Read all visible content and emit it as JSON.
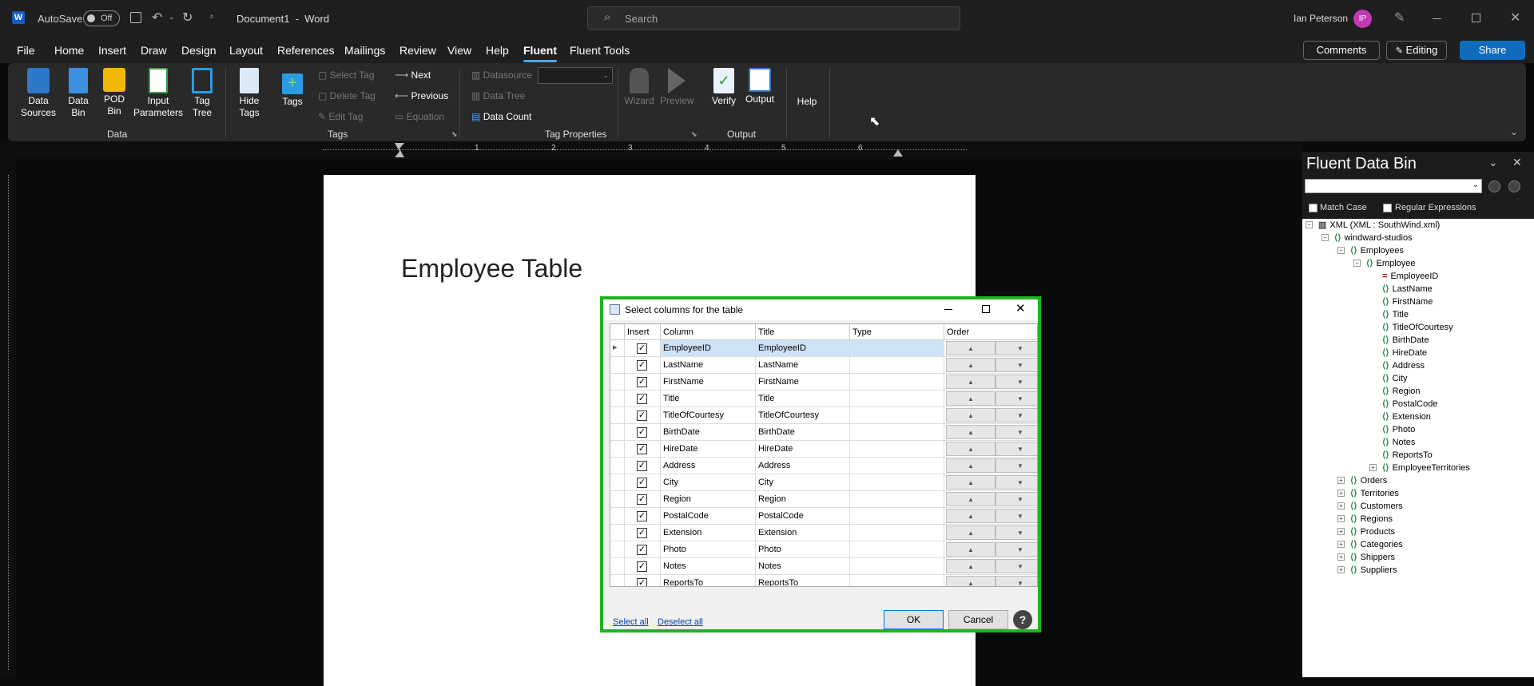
{
  "titlebar": {
    "autosave_label": "AutoSave",
    "autosave_state": "Off",
    "doc_title": "Document1  -  Word",
    "search_placeholder": "Search",
    "user_name": "Ian Peterson",
    "user_initials": "IP"
  },
  "menu": {
    "items": [
      "File",
      "Home",
      "Insert",
      "Draw",
      "Design",
      "Layout",
      "References",
      "Mailings",
      "Review",
      "View",
      "Help",
      "Fluent",
      "Fluent Tools"
    ],
    "active": "Fluent",
    "comments": "Comments",
    "editing": "Editing",
    "share": "Share"
  },
  "ribbon": {
    "data_sources": "Data Sources",
    "data_bin": "Data Bin",
    "pod_bin": "POD Bin",
    "input_parameters": "Input Parameters",
    "tag_tree": "Tag Tree",
    "group_data": "Data",
    "hide_tags": "Hide Tags",
    "tags": "Tags",
    "select_tag": "Select Tag",
    "delete_tag": "Delete Tag",
    "edit_tag": "Edit Tag",
    "next": "Next",
    "previous": "Previous",
    "equation": "Equation",
    "group_tags": "Tags",
    "datasource": "Datasource",
    "data_tree": "Data Tree",
    "data_count": "Data Count",
    "group_tag_properties": "Tag Properties",
    "wizard": "Wizard",
    "preview": "Preview",
    "verify": "Verify",
    "output": "Output",
    "group_output": "Output",
    "help": "Help"
  },
  "ruler": {
    "numbers": [
      "1",
      "2",
      "3",
      "4",
      "5",
      "6"
    ]
  },
  "document": {
    "title": "Employee Table"
  },
  "dialog": {
    "title": "Select columns for the table",
    "headers": {
      "insert": "Insert",
      "column": "Column",
      "title": "Title",
      "type": "Type",
      "order": "Order"
    },
    "rows": [
      {
        "column": "EmployeeID",
        "title": "EmployeeID",
        "checked": true
      },
      {
        "column": "LastName",
        "title": "LastName",
        "checked": true
      },
      {
        "column": "FirstName",
        "title": "FirstName",
        "checked": true
      },
      {
        "column": "Title",
        "title": "Title",
        "checked": true
      },
      {
        "column": "TitleOfCourtesy",
        "title": "TitleOfCourtesy",
        "checked": true
      },
      {
        "column": "BirthDate",
        "title": "BirthDate",
        "checked": true
      },
      {
        "column": "HireDate",
        "title": "HireDate",
        "checked": true
      },
      {
        "column": "Address",
        "title": "Address",
        "checked": true
      },
      {
        "column": "City",
        "title": "City",
        "checked": true
      },
      {
        "column": "Region",
        "title": "Region",
        "checked": true
      },
      {
        "column": "PostalCode",
        "title": "PostalCode",
        "checked": true
      },
      {
        "column": "Extension",
        "title": "Extension",
        "checked": true
      },
      {
        "column": "Photo",
        "title": "Photo",
        "checked": true
      },
      {
        "column": "Notes",
        "title": "Notes",
        "checked": true
      },
      {
        "column": "ReportsTo",
        "title": "ReportsTo",
        "checked": true
      }
    ],
    "select_all": "Select all",
    "deselect_all": "Deselect all",
    "ok": "OK",
    "cancel": "Cancel",
    "help": "?"
  },
  "panel": {
    "title": "Fluent Data Bin",
    "match_case": "Match Case",
    "regex": "Regular Expressions",
    "tree": {
      "root": "XML (XML : SouthWind.xml)",
      "l1": "windward-studios",
      "l2": "Employees",
      "l3": "Employee",
      "fields": [
        "EmployeeID",
        "LastName",
        "FirstName",
        "Title",
        "TitleOfCourtesy",
        "BirthDate",
        "HireDate",
        "Address",
        "City",
        "Region",
        "PostalCode",
        "Extension",
        "Photo",
        "Notes",
        "ReportsTo",
        "EmployeeTerritories"
      ],
      "siblings": [
        "Orders",
        "Territories",
        "Customers",
        "Regions",
        "Products",
        "Categories",
        "Shippers",
        "Suppliers"
      ]
    }
  },
  "colors": {
    "accent": "#4da3ff",
    "dialog_border": "#1fb41f",
    "share_bg": "#0f6cbd",
    "avatar": "#c239b3"
  }
}
